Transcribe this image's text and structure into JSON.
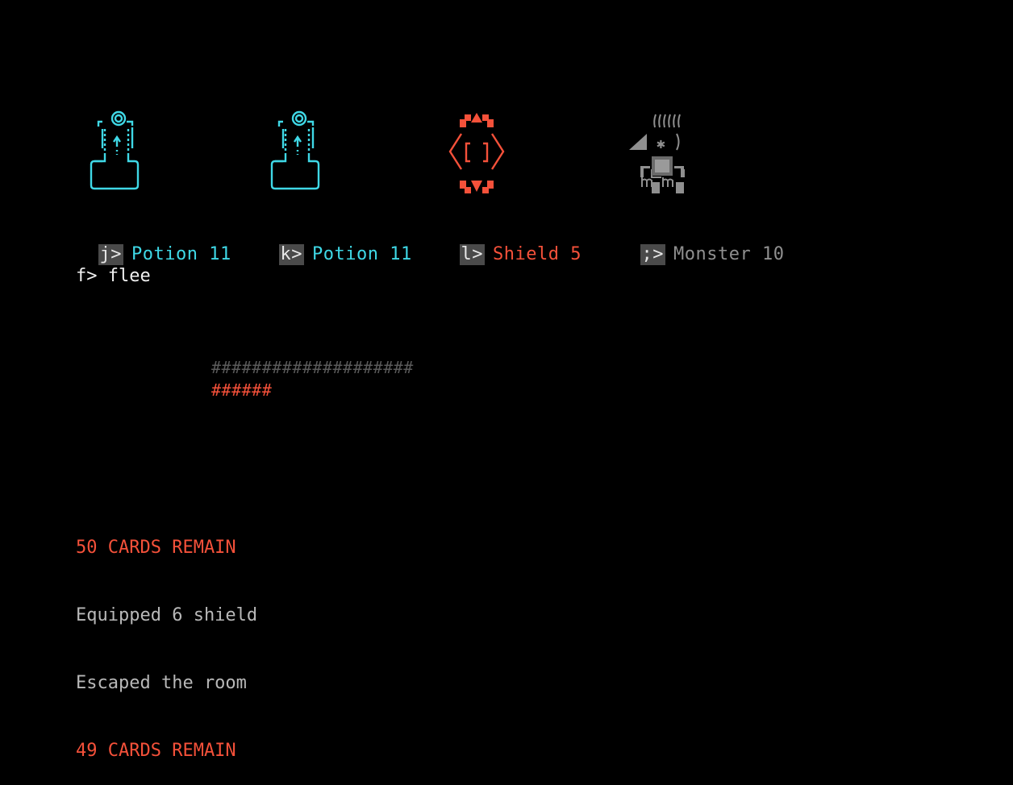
{
  "colors": {
    "potion": "#3fd8e6",
    "shield": "#f5513a",
    "monster": "#8f8f8f",
    "key_bg": "#4a4a4a",
    "bar_empty": "#5a5a5a",
    "bar_fill": "#f5513a",
    "log_alert": "#f5513a",
    "log_text": "#b8b8b8"
  },
  "cards": [
    {
      "key": "j>",
      "name": "Potion 11",
      "kind": "potion",
      "icon": "potion-icon"
    },
    {
      "key": "k>",
      "name": "Potion 11",
      "kind": "potion",
      "icon": "potion-icon"
    },
    {
      "key": "l>",
      "name": "Shield 5",
      "kind": "shield",
      "icon": "shield-icon"
    },
    {
      "key": ";>",
      "name": "Monster 10",
      "kind": "monster",
      "icon": "monster-icon"
    }
  ],
  "flee": {
    "key": "f>",
    "label": "flee"
  },
  "health_bar": {
    "max_row": "####################",
    "current_row": "######",
    "max": 20,
    "current": 6
  },
  "log": [
    {
      "text": "50 CARDS REMAIN",
      "style": "alert"
    },
    {
      "text": "Equipped 6 shield",
      "style": "text"
    },
    {
      "text": "Escaped the room",
      "style": "text"
    },
    {
      "text": "49 CARDS REMAIN",
      "style": "alert"
    }
  ]
}
